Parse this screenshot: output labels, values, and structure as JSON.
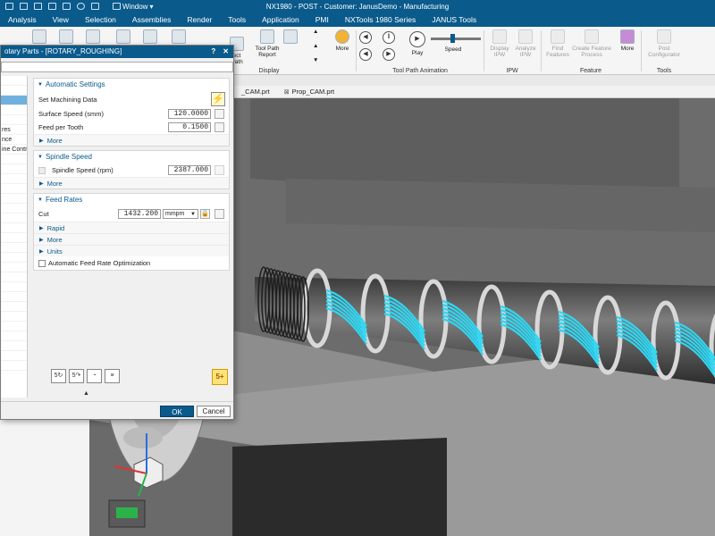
{
  "titlebar": {
    "window_menu": "Window",
    "title": "NX1980 - POST - Customer: JanusDemo - Manufacturing"
  },
  "menu": {
    "items": [
      "Analysis",
      "View",
      "Selection",
      "Assemblies",
      "Render",
      "Tools",
      "Application",
      "PMI",
      "NXTools 1980 Series",
      "JANUS Tools"
    ]
  },
  "ribbon": {
    "ect_path": "ect\nPath",
    "tool_path_report": "Tool Path\nReport",
    "display_group": "Display",
    "more_1": "More",
    "play": "Play",
    "speed": "Speed",
    "animation_group": "Tool Path Animation",
    "display_ipw": "Display\nIPW",
    "analyze_ipw": "Analyze\nIPW",
    "ipw_group": "IPW",
    "find_features": "Find\nFeatures",
    "create_feature_process": "Create Feature\nProcess",
    "feature_group": "Feature",
    "more_2": "More",
    "post_configurator": "Post\nConfigurator",
    "tools_group": "Tools"
  },
  "doc_tabs": [
    "_CAM.prt",
    "Prop_CAM.prt"
  ],
  "dialog": {
    "title": "otary Parts - [ROTARY_ROUGHING]",
    "tree": [
      "",
      "",
      "",
      "",
      "",
      "res",
      "nce",
      "ine Contr"
    ],
    "automatic_settings": {
      "header": "Automatic Settings",
      "set_machining_data": "Set Machining Data",
      "surface_speed_label": "Surface Speed (smm)",
      "surface_speed_value": "120.0000",
      "feed_per_tooth_label": "Feed per Tooth",
      "feed_per_tooth_value": "0.1500",
      "more": "More"
    },
    "spindle_speed": {
      "header": "Spindle Speed",
      "label": "Spindle Speed (rpm)",
      "value": "2387.000",
      "more": "More"
    },
    "feed_rates": {
      "header": "Feed Rates",
      "cut_label": "Cut",
      "cut_value": "1432.200",
      "cut_unit": "mmpm",
      "rapid": "Rapid",
      "more": "More",
      "units": "Units",
      "auto_opt": "Automatic Feed Rate Optimization"
    },
    "ok": "OK",
    "cancel": "Cancel"
  },
  "colors": {
    "title_blue": "#0a5a8c",
    "toolpath_cyan": "#2fd6f2",
    "ok_blue": "#0a5a8c"
  }
}
